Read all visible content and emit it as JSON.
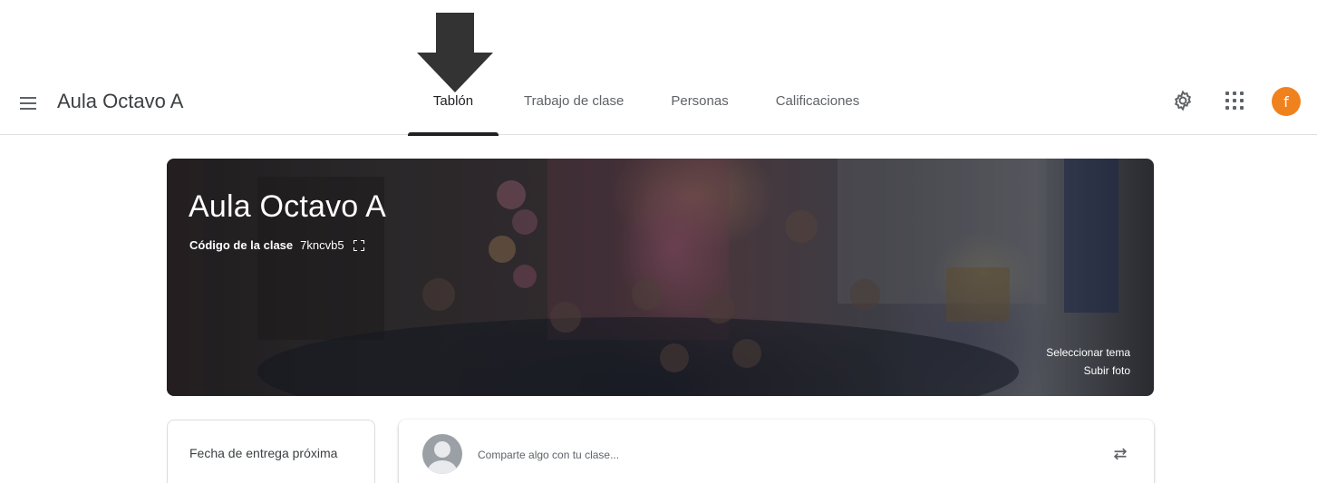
{
  "header": {
    "title": "Aula Octavo A",
    "menu_icon": "hamburger-menu-icon",
    "tabs": [
      {
        "label": "Tablón",
        "active": true
      },
      {
        "label": "Trabajo de clase",
        "active": false
      },
      {
        "label": "Personas",
        "active": false
      },
      {
        "label": "Calificaciones",
        "active": false
      }
    ],
    "settings_icon": "gear-icon",
    "apps_icon": "apps-grid-icon",
    "avatar_letter": "f",
    "avatar_color": "#f0821e"
  },
  "banner": {
    "title": "Aula Octavo A",
    "code_label": "Código de la clase",
    "code_value": "7kncvb5",
    "select_theme": "Seleccionar tema",
    "upload_photo": "Subir foto"
  },
  "upcoming": {
    "title": "Fecha de entrega próxima"
  },
  "stream": {
    "share_placeholder": "Comparte algo con tu clase..."
  },
  "annotation": {
    "arrow_color": "#333333"
  }
}
